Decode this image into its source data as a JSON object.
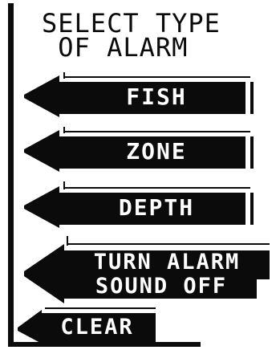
{
  "title": {
    "line1": "SELECT TYPE",
    "line2": "OF ALARM"
  },
  "menu": {
    "items": [
      {
        "label": "FISH",
        "icon": "left-arrow-icon"
      },
      {
        "label": "ZONE",
        "icon": "left-arrow-icon"
      },
      {
        "label": "DEPTH",
        "icon": "left-arrow-icon"
      },
      {
        "label_line1": "TURN ALARM",
        "label_line2": "SOUND OFF",
        "icon": "left-arrow-icon"
      },
      {
        "label": "CLEAR",
        "icon": "left-arrow-icon"
      }
    ]
  },
  "colors": {
    "ink": "#0b0b0b",
    "paper": "#ffffff"
  }
}
